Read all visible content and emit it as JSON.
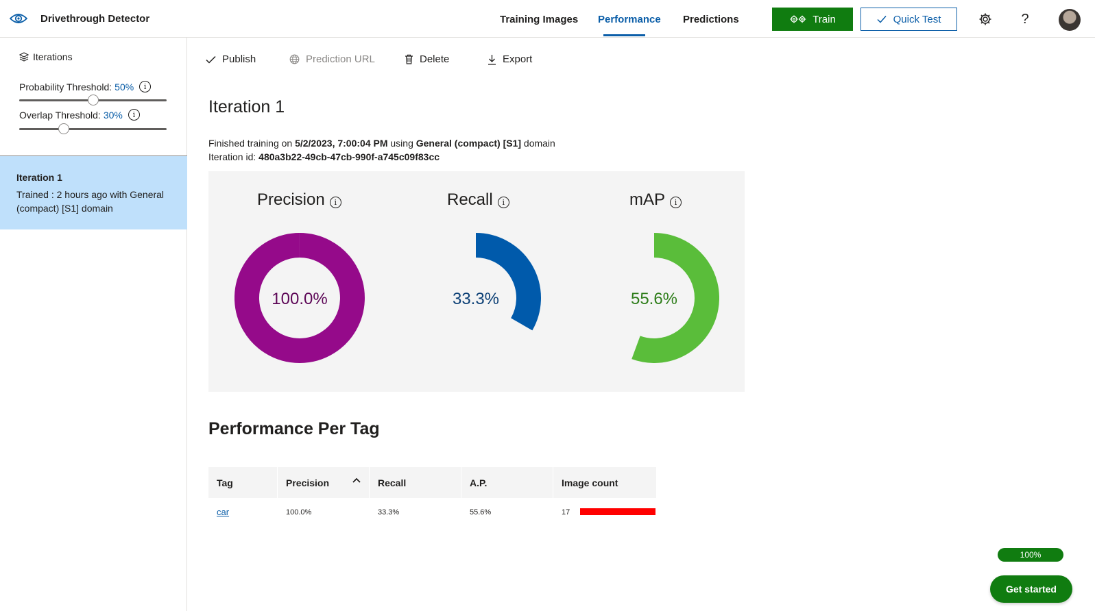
{
  "app": {
    "title": "Drivethrough Detector"
  },
  "nav": {
    "tabs": [
      {
        "label": "Training Images",
        "active": false
      },
      {
        "label": "Performance",
        "active": true
      },
      {
        "label": "Predictions",
        "active": false
      }
    ],
    "train_label": "Train",
    "quick_test_label": "Quick Test",
    "icons": [
      "settings-icon",
      "help-icon",
      "avatar"
    ]
  },
  "sidebar": {
    "iterations_label": "Iterations",
    "probability_threshold": {
      "label": "Probability Threshold:",
      "value": "50%",
      "fraction": 0.5
    },
    "overlap_threshold": {
      "label": "Overlap Threshold:",
      "value": "30%",
      "fraction": 0.3
    },
    "selected_iteration": {
      "title": "Iteration 1",
      "description": "Trained : 2 hours ago with General (compact) [S1] domain"
    }
  },
  "toolbar": {
    "publish": "Publish",
    "prediction_url": "Prediction URL",
    "delete": "Delete",
    "export": "Export"
  },
  "iteration": {
    "title": "Iteration 1",
    "finished_prefix": "Finished training on",
    "finished_date": "5/2/2023, 7:00:04 PM",
    "using_word": "using",
    "domain_name": "General (compact) [S1]",
    "domain_suffix": "domain",
    "id_label": "Iteration id:",
    "id_value": "480a3b22-49cb-47cb-990f-a745c09f83cc"
  },
  "metrics": [
    {
      "label": "Precision",
      "value_text": "100.0%",
      "fraction": 1.0,
      "color": "#950a8a",
      "text_color": "#5c0656"
    },
    {
      "label": "Recall",
      "value_text": "33.3%",
      "fraction": 0.333,
      "color": "#005aab",
      "text_color": "#0b3f75"
    },
    {
      "label": "mAP",
      "value_text": "55.6%",
      "fraction": 0.556,
      "color": "#5abd3a",
      "text_color": "#2e7d1a"
    }
  ],
  "per_tag": {
    "title": "Performance Per Tag",
    "columns": [
      "Tag",
      "Precision",
      "Recall",
      "A.P.",
      "Image count"
    ],
    "rows": [
      {
        "tag": "car",
        "precision": "100.0%",
        "recall": "33.3%",
        "ap": "55.6%",
        "image_count": "17"
      }
    ]
  },
  "bottom": {
    "progress": "100%",
    "get_started": "Get started"
  }
}
